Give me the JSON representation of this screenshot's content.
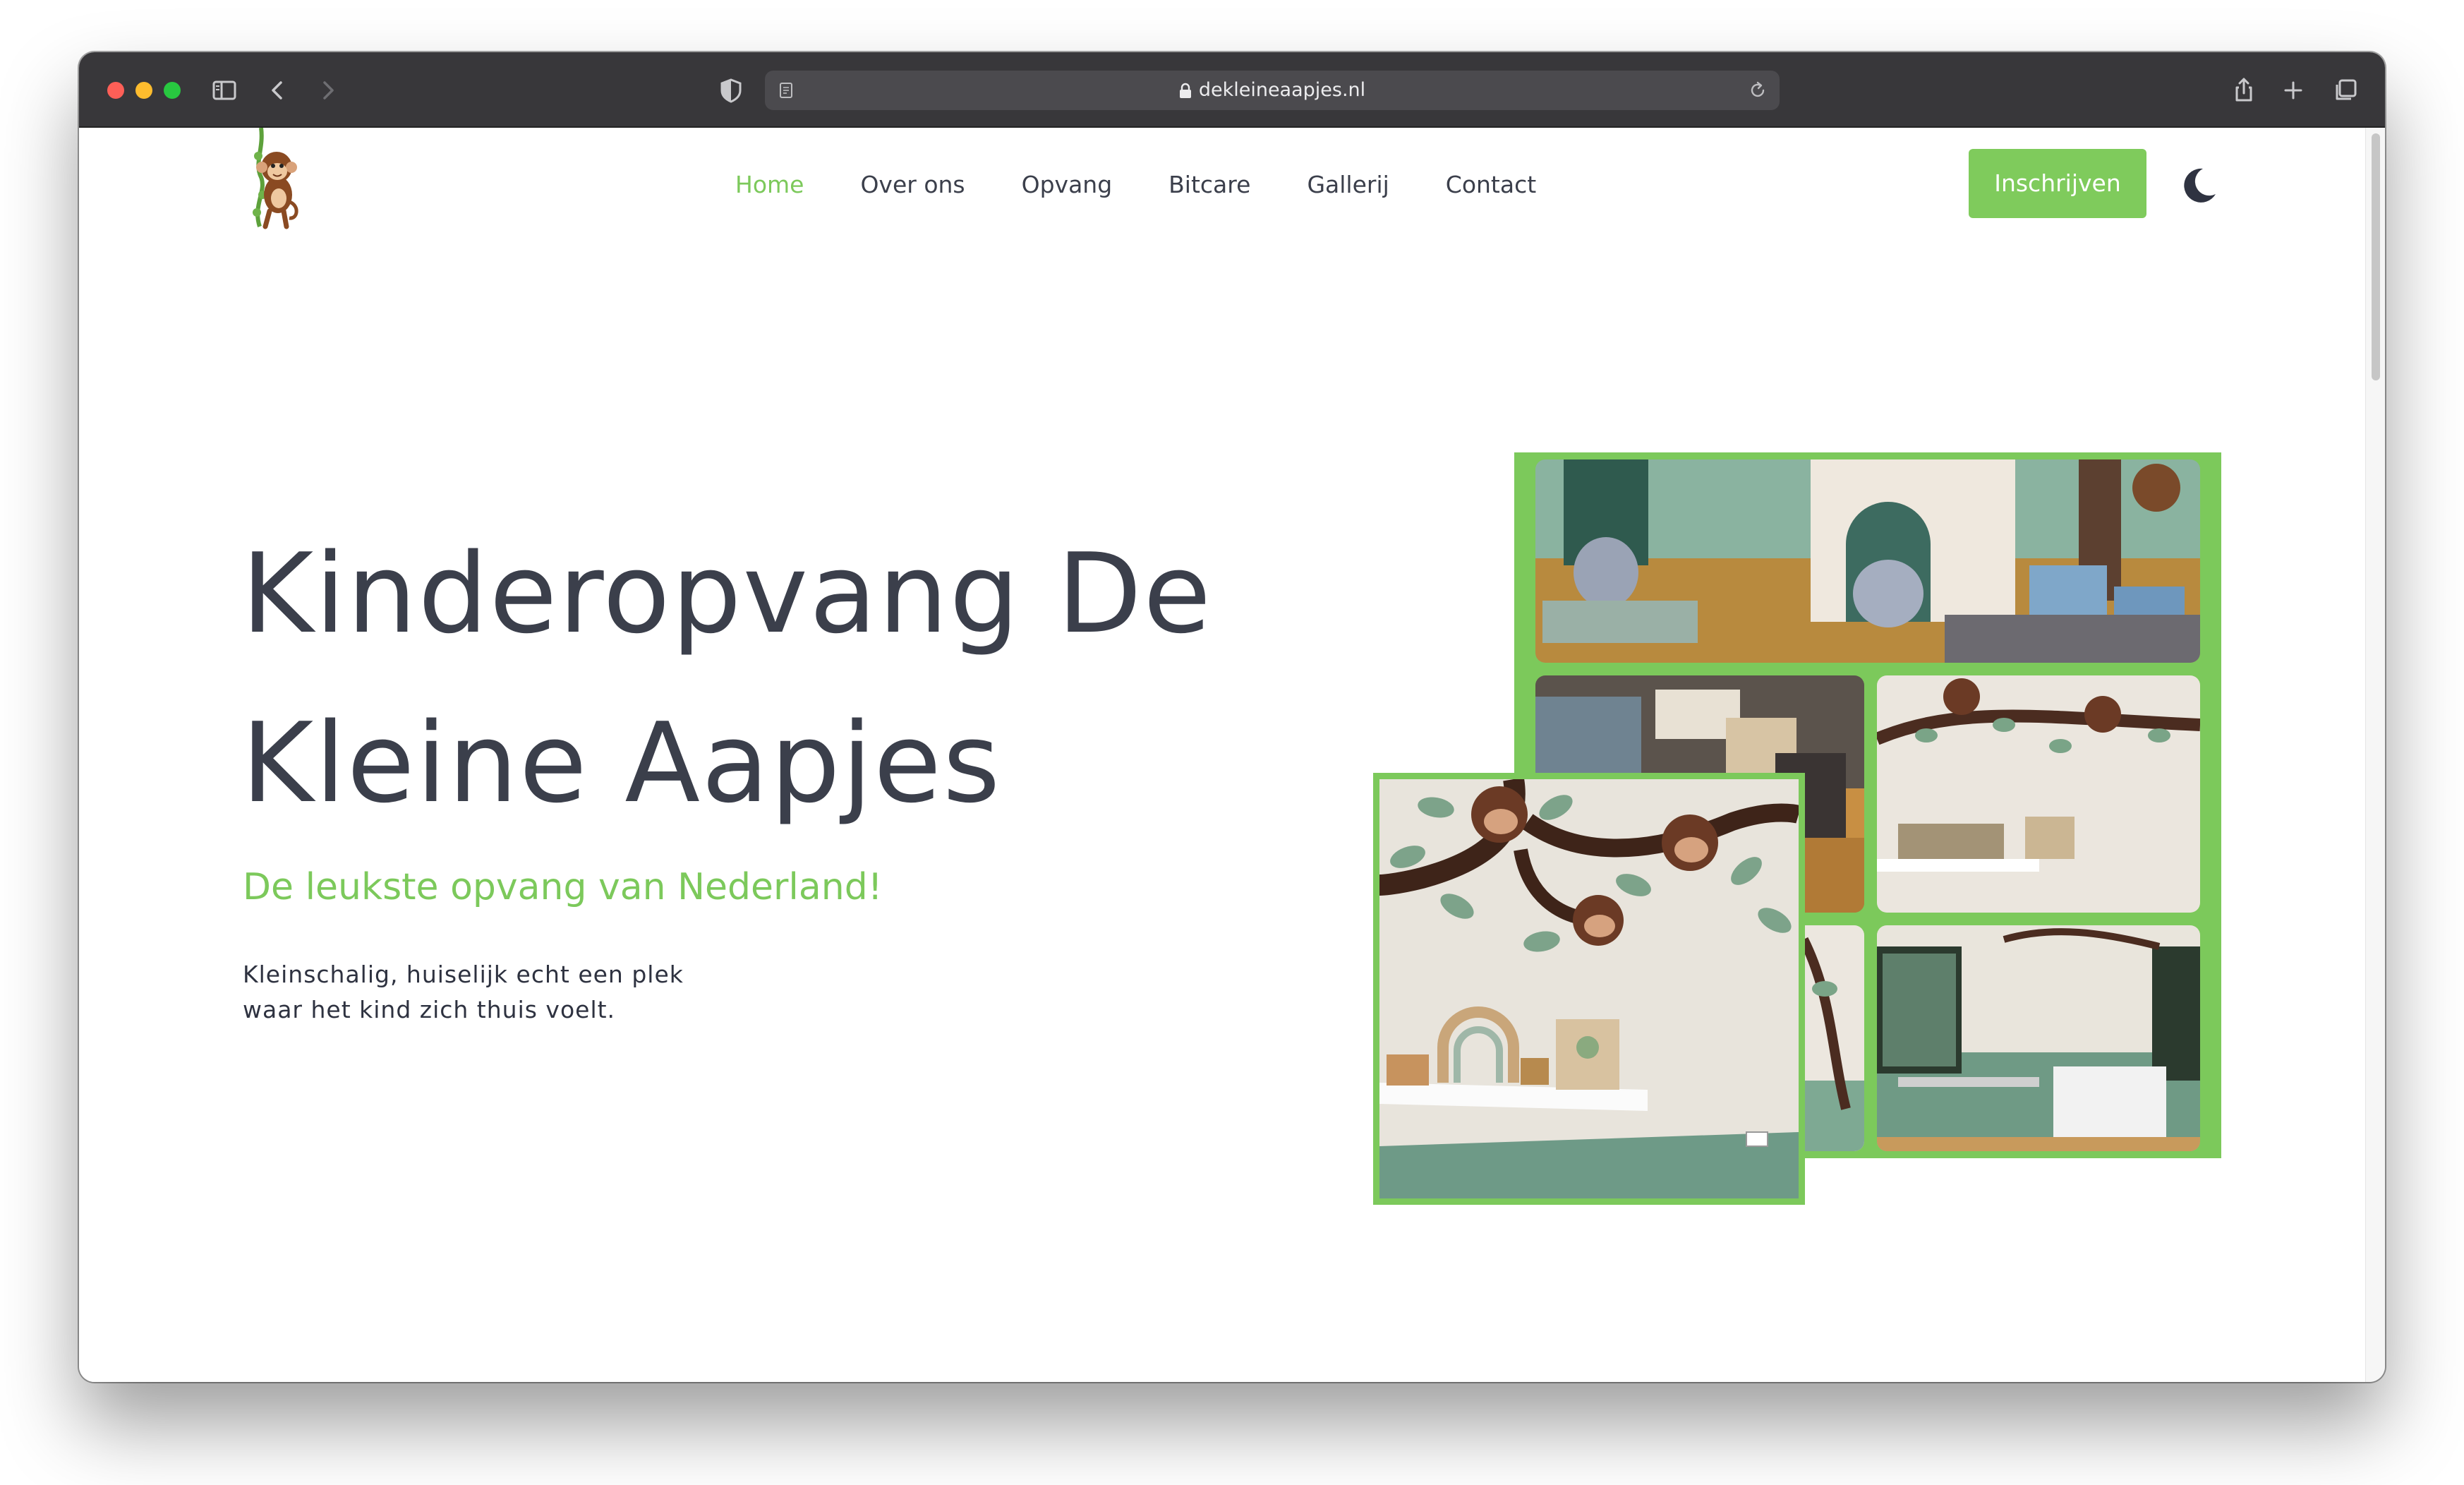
{
  "browser": {
    "url": "dekleineaapjes.nl",
    "icons": [
      "sidebar-icon",
      "back-icon",
      "forward-icon",
      "shield-icon",
      "reader-icon",
      "lock-icon",
      "reload-icon",
      "share-icon",
      "new-tab-icon",
      "tabs-icon"
    ]
  },
  "site": {
    "logo_icon": "monkey-on-vine",
    "nav": {
      "items": [
        {
          "label": "Home",
          "active": true
        },
        {
          "label": "Over ons",
          "active": false
        },
        {
          "label": "Opvang",
          "active": false
        },
        {
          "label": "Bitcare",
          "active": false
        },
        {
          "label": "Gallerij",
          "active": false
        },
        {
          "label": "Contact",
          "active": false
        }
      ]
    },
    "signup_label": "Inschrijven",
    "theme_toggle_icon": "moon-icon"
  },
  "hero": {
    "title_line1": "Kinderopvang De",
    "title_line2": "Kleine Aapjes",
    "subtitle": "De leukste opvang van Nederland!",
    "text_line1": "Kleinschalig, huiselijk echt een plek",
    "text_line2": "waar het kind zich thuis voelt."
  },
  "colors": {
    "accent": "#7cc95b",
    "text_dark": "#3b3f4b",
    "chrome": "#38373a"
  }
}
